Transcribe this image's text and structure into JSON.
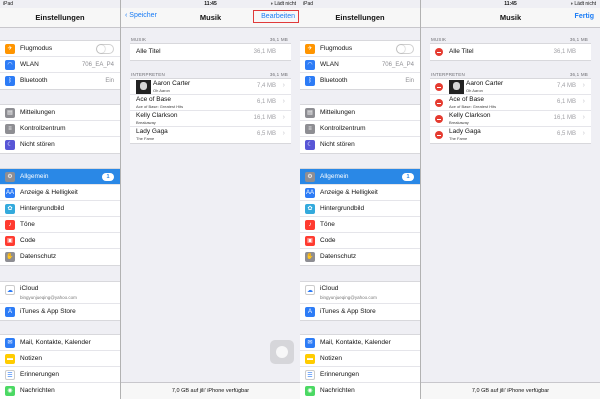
{
  "status": {
    "left": "iPad",
    "time": "11:45",
    "right": "◑ Lädt nicht"
  },
  "settings": {
    "title": "Einstellungen",
    "group1": [
      {
        "label": "Flugmodus",
        "icon": "airplane-icon",
        "color": "#ff9500",
        "glyph": "✈",
        "toggle": true
      },
      {
        "label": "WLAN",
        "icon": "wifi-icon",
        "color": "#2d7cf6",
        "glyph": "◠",
        "value": "706_EA_P4"
      },
      {
        "label": "Bluetooth",
        "icon": "bluetooth-icon",
        "color": "#2d7cf6",
        "glyph": "ᛒ",
        "value": "Ein"
      }
    ],
    "group2": [
      {
        "label": "Mitteilungen",
        "icon": "notifications-icon",
        "color": "#8e8e93",
        "glyph": "▤"
      },
      {
        "label": "Kontrollzentrum",
        "icon": "control-center-icon",
        "color": "#8e8e93",
        "glyph": "≡"
      },
      {
        "label": "Nicht stören",
        "icon": "moon-icon",
        "color": "#5856d6",
        "glyph": "☾"
      }
    ],
    "group3": [
      {
        "label": "Allgemein",
        "icon": "gear-icon",
        "color": "#8e8e93",
        "glyph": "⚙",
        "badge": "1",
        "selected": true
      },
      {
        "label": "Anzeige & Helligkeit",
        "icon": "brightness-icon",
        "color": "#2d7cf6",
        "glyph": "AA"
      },
      {
        "label": "Hintergrundbild",
        "icon": "wallpaper-icon",
        "color": "#34aadc",
        "glyph": "✿"
      },
      {
        "label": "Töne",
        "icon": "sound-icon",
        "color": "#ff3b30",
        "glyph": "♪"
      },
      {
        "label": "Code",
        "icon": "lock-icon",
        "color": "#ff3b30",
        "glyph": "▣"
      },
      {
        "label": "Datenschutz",
        "icon": "hand-icon",
        "color": "#8e8e93",
        "glyph": "✋"
      }
    ],
    "icloud": {
      "label": "iCloud",
      "sub": "bingyunjueqing@yahoo.com",
      "icon": "icloud-icon",
      "color": "#ffffff",
      "glyph": "☁"
    },
    "itunes": {
      "label": "iTunes & App Store",
      "icon": "app-store-icon",
      "color": "#2d7cf6",
      "glyph": "A"
    },
    "group5": [
      {
        "label": "Mail, Kontakte, Kalender",
        "icon": "mail-icon",
        "color": "#2d7cf6",
        "glyph": "✉"
      },
      {
        "label": "Notizen",
        "icon": "notes-icon",
        "color": "#ffcc00",
        "glyph": "▬"
      },
      {
        "label": "Erinnerungen",
        "icon": "reminders-icon",
        "color": "#ffffff",
        "glyph": "☰"
      },
      {
        "label": "Nachrichten",
        "icon": "messages-icon",
        "color": "#4cd964",
        "glyph": "◉"
      }
    ]
  },
  "music": {
    "back": "Speicher",
    "title": "Musik",
    "edit": "Bearbeiten",
    "done": "Fertig",
    "musik_header": "MUSIK",
    "musik_size": "36,1 MB",
    "all_titles": "Alle Titel",
    "all_size": "36,1 MB",
    "interpreten_header": "INTERPRETEN",
    "interpreten_size": "36,1 MB",
    "artists": [
      {
        "name": "Aaron Carter",
        "album": "Oh Aaron",
        "size": "7,4 MB",
        "cover": true
      },
      {
        "name": "Ace of Base",
        "album": "Ace of Base: Greatest Hits",
        "size": "6,1 MB"
      },
      {
        "name": "Kelly Clarkson",
        "album": "Breakaway",
        "size": "16,1 MB"
      },
      {
        "name": "Lady Gaga",
        "album": "The Fame",
        "size": "6,5 MB"
      }
    ],
    "footer": "7,0 GB auf jili' iPhone verfügbar"
  }
}
